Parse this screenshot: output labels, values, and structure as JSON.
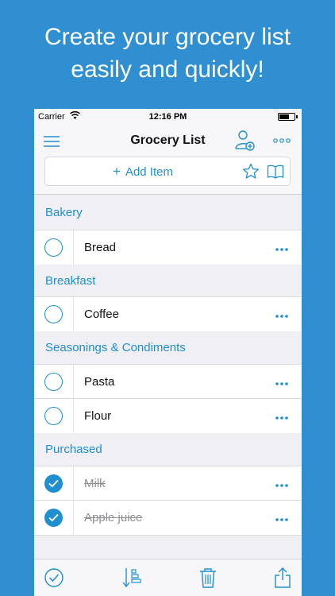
{
  "promo": {
    "line1": "Create your grocery list",
    "line2": "easily and quickly!"
  },
  "status_bar": {
    "carrier": "Carrier",
    "time": "12:16 PM"
  },
  "nav": {
    "title": "Grocery List",
    "left_icon": "menu-icon",
    "right_icons": [
      "user-add-icon",
      "more-icon"
    ]
  },
  "add_bar": {
    "plus": "+",
    "label": "Add Item",
    "icons": [
      "star-icon",
      "book-icon"
    ]
  },
  "sections": [
    {
      "title": "Bakery",
      "items": [
        {
          "name": "Bread",
          "checked": false
        }
      ]
    },
    {
      "title": "Breakfast",
      "items": [
        {
          "name": "Coffee",
          "checked": false
        }
      ]
    },
    {
      "title": "Seasonings & Condiments",
      "items": [
        {
          "name": "Pasta",
          "checked": false
        },
        {
          "name": "Flour",
          "checked": false
        }
      ]
    },
    {
      "title": "Purchased",
      "items": [
        {
          "name": "Milk",
          "checked": true
        },
        {
          "name": "Apple juice",
          "checked": true
        }
      ]
    }
  ],
  "toolbar": {
    "icons": [
      "check-all-icon",
      "sort-icon",
      "trash-icon",
      "share-icon"
    ]
  },
  "colors": {
    "background": "#2f8fd0",
    "accent": "#1f8fd0",
    "done_text": "#8e8e93"
  }
}
